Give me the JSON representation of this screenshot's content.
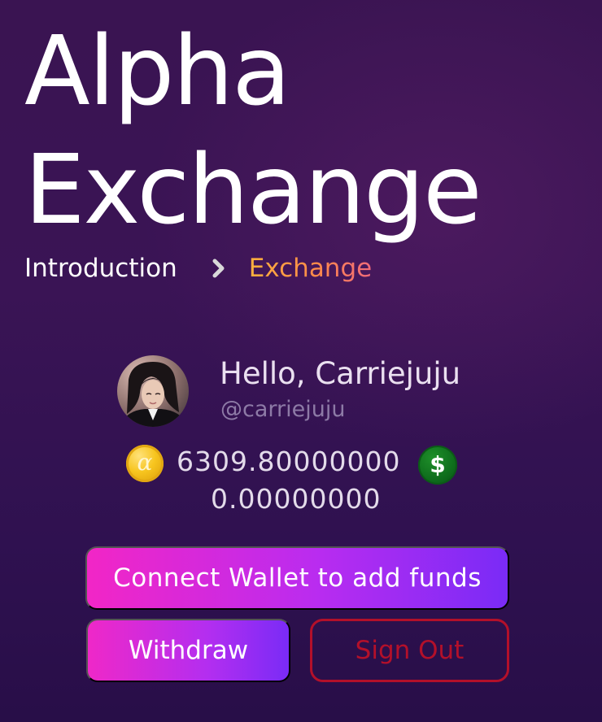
{
  "header": {
    "title_line1": "Alpha",
    "title_line2": "Exchange"
  },
  "breadcrumb": {
    "items": [
      {
        "label": "Introduction"
      },
      {
        "label": "Exchange"
      }
    ],
    "separator_icon": "chevron-right-icon"
  },
  "user": {
    "greeting": "Hello, Carriejuju",
    "handle": "@carriejuju"
  },
  "balances": {
    "alpha": {
      "icon": "alpha-coin-icon",
      "icon_glyph": "α",
      "amount": "6309.80000000"
    },
    "usd": {
      "icon": "dollar-coin-icon",
      "icon_glyph": "$",
      "amount": "0.00000000"
    }
  },
  "actions": {
    "connect_wallet_label": "Connect Wallet to add funds",
    "withdraw_label": "Withdraw",
    "sign_out_label": "Sign Out"
  },
  "colors": {
    "background": "#361350",
    "accent_gradient_start": "#f226c6",
    "accent_gradient_end": "#7a2bf6",
    "breadcrumb_active": "#ffa24a",
    "sign_out": "#b3102a",
    "alpha_coin": "#f7c51f",
    "dollar_coin": "#0e6d1c"
  }
}
